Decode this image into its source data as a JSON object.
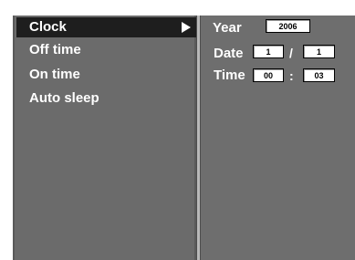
{
  "menu": {
    "items": [
      {
        "label": "Clock",
        "active": true,
        "arrow_icon": "right-triangle-icon"
      },
      {
        "label": "Off time",
        "active": false
      },
      {
        "label": "On time",
        "active": false
      },
      {
        "label": "Auto sleep",
        "active": false
      }
    ]
  },
  "clock": {
    "year_label": "Year",
    "year_value": "2006",
    "date_label": "Date",
    "date_month": "1",
    "date_separator": "/",
    "date_day": "1",
    "time_label": "Time",
    "time_hour": "00",
    "time_separator": ":",
    "time_minute": "03"
  },
  "colors": {
    "panel_bg": "#6e6e6e",
    "active_item_bg": "#1e1e1e",
    "text": "#ffffff",
    "field_bg": "#ffffff"
  }
}
